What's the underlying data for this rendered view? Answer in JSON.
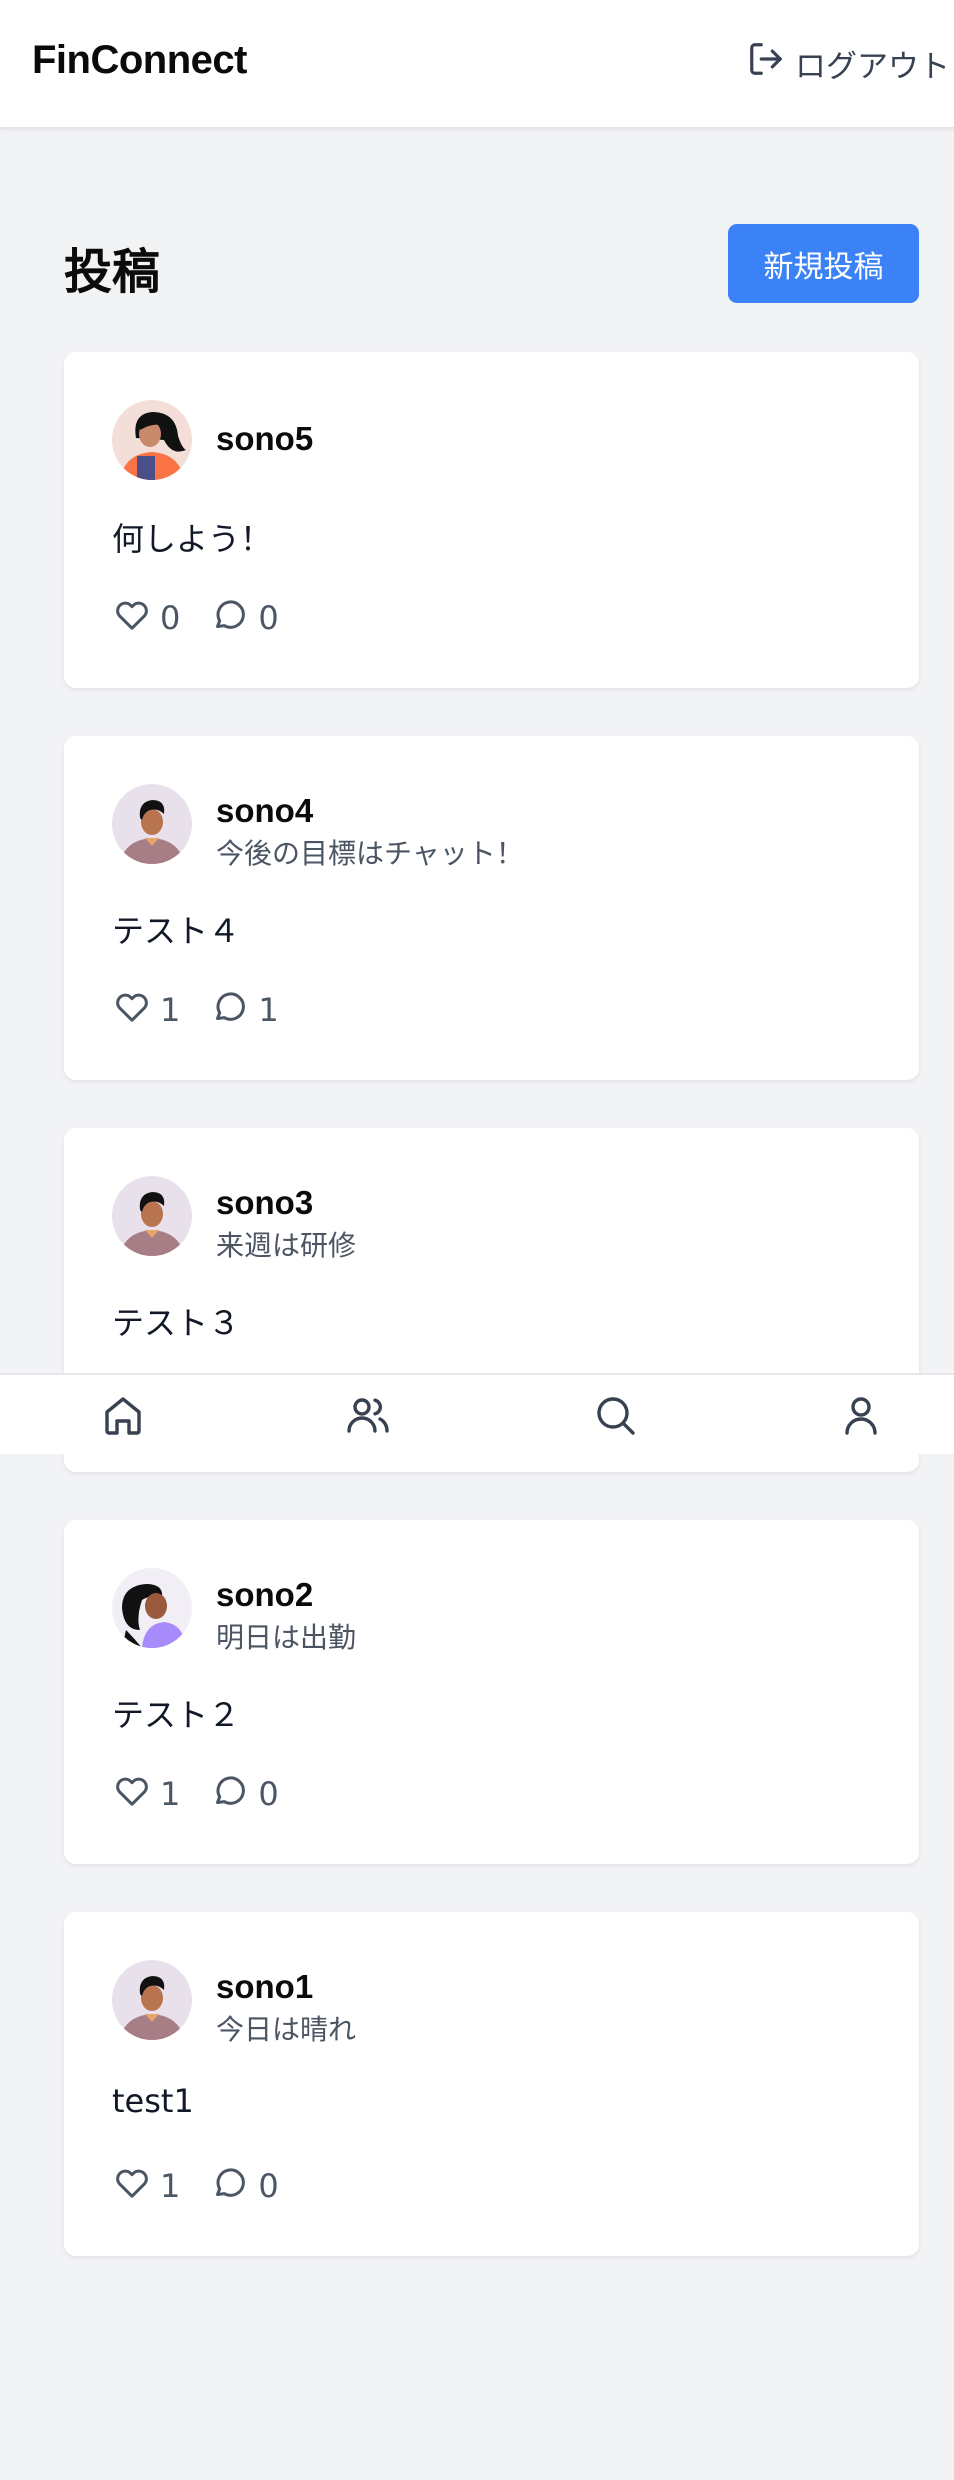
{
  "header": {
    "brand": "FinConnect",
    "logout_label": "ログアウト",
    "logout_icon": "logout-icon"
  },
  "main": {
    "title": "投稿",
    "new_post_label": "新規投稿"
  },
  "posts": [
    {
      "username": "sono5",
      "status": "",
      "content": "何しよう！",
      "likes": "0",
      "comments": "0",
      "avatar": "woman-orange-avatar"
    },
    {
      "username": "sono4",
      "status": "今後の目標はチャット！",
      "content": "テスト４",
      "likes": "1",
      "comments": "1",
      "avatar": "man-avatar"
    },
    {
      "username": "sono3",
      "status": "来週は研修",
      "content": "テスト３",
      "likes": "",
      "comments": "",
      "avatar": "man-avatar"
    },
    {
      "username": "sono2",
      "status": "明日は出勤",
      "content": "テスト２",
      "likes": "1",
      "comments": "0",
      "avatar": "woman-purple-avatar"
    },
    {
      "username": "sono1",
      "status": "今日は晴れ",
      "content": "test1",
      "likes": "1",
      "comments": "0",
      "avatar": "man-avatar"
    }
  ],
  "bottom_nav": {
    "items": [
      "home-icon",
      "users-icon",
      "search-icon",
      "profile-icon"
    ]
  },
  "colors": {
    "accent": "#3b82f6",
    "background": "#f2f3f5",
    "card": "#ffffff"
  }
}
